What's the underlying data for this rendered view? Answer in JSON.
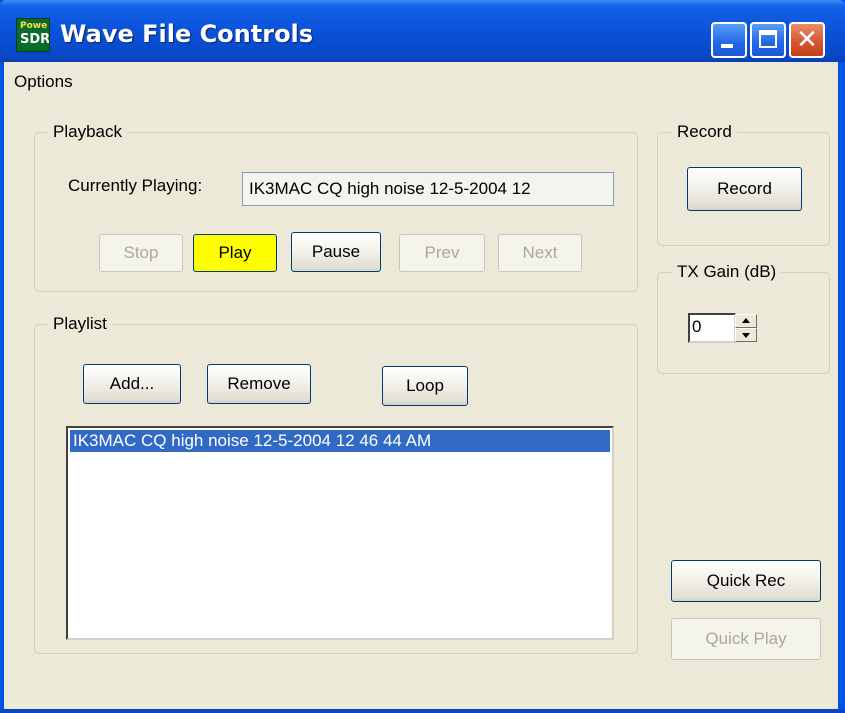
{
  "window": {
    "title": "Wave File Controls",
    "logo_line1": "PowerSDR",
    "logo_line2": "SDR"
  },
  "menu": {
    "options_label": "Options"
  },
  "playback": {
    "group_label": "Playback",
    "currently_playing_label": "Currently Playing:",
    "currently_playing_value": "IK3MAC CQ high noise 12-5-2004 12",
    "buttons": {
      "stop": "Stop",
      "play": "Play",
      "pause": "Pause",
      "prev": "Prev",
      "next": "Next"
    }
  },
  "record": {
    "group_label": "Record",
    "record_button": "Record"
  },
  "tx_gain": {
    "group_label": "TX Gain (dB)",
    "value": "0"
  },
  "playlist": {
    "group_label": "Playlist",
    "add_button": "Add...",
    "remove_button": "Remove",
    "loop_button": "Loop",
    "items": [
      "IK3MAC CQ high noise 12-5-2004 12 46 44 AM"
    ]
  },
  "quick": {
    "quick_rec": "Quick Rec",
    "quick_play": "Quick Play"
  },
  "colors": {
    "titlebar": "#0a52d9",
    "play_highlight": "#ffff00",
    "selection": "#316ac5",
    "client_bg": "#ece9d8"
  }
}
